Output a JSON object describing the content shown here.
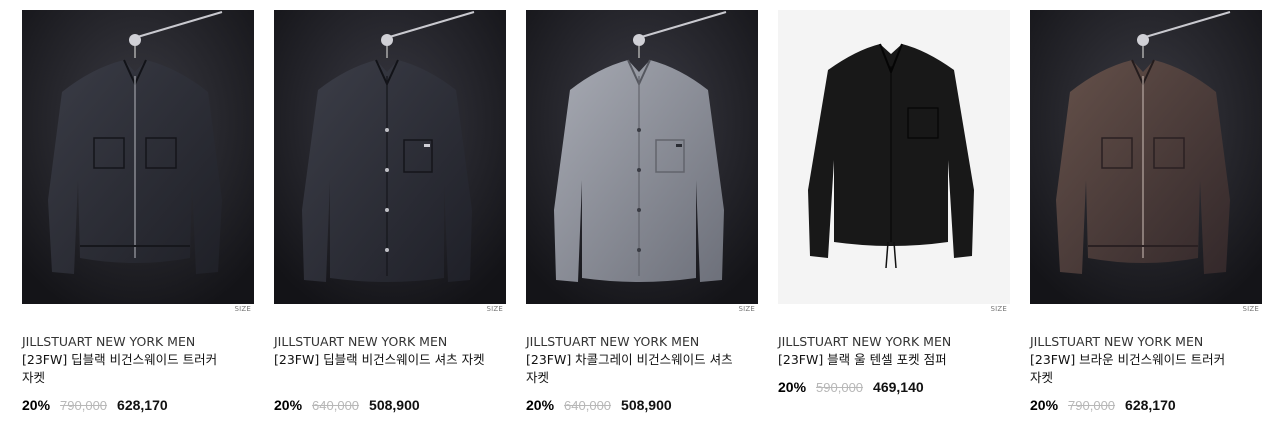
{
  "size_label": "SIZE",
  "products": [
    {
      "brand": "JILLSTUART NEW YORK MEN",
      "name": "[23FW] 딥블랙 비건스웨이드 트러커 자켓",
      "discount": "20%",
      "original_price": "790,000",
      "sale_price": "628,170",
      "colors": {
        "background": "#1c1c21",
        "jacket": "#2b2d35"
      }
    },
    {
      "brand": "JILLSTUART NEW YORK MEN",
      "name": "[23FW] 딥블랙 비건스웨이드 셔츠 자켓",
      "discount": "20%",
      "original_price": "640,000",
      "sale_price": "508,900",
      "colors": {
        "background": "#1b1b20",
        "jacket": "#2e3039"
      }
    },
    {
      "brand": "JILLSTUART NEW YORK MEN",
      "name": "[23FW] 차콜그레이 비건스웨이드 셔츠 자켓",
      "discount": "20%",
      "original_price": "640,000",
      "sale_price": "508,900",
      "colors": {
        "background": "#1d1d22",
        "jacket": "#8c8f99"
      }
    },
    {
      "brand": "JILLSTUART NEW YORK MEN",
      "name": "[23FW] 블랙 울 텐셀 포켓 점퍼",
      "discount": "20%",
      "original_price": "590,000",
      "sale_price": "469,140",
      "colors": {
        "background": "#f4f4f4",
        "jacket": "#151515"
      }
    },
    {
      "brand": "JILLSTUART NEW YORK MEN",
      "name": "[23FW] 브라운 비건스웨이드 트러커 자켓",
      "discount": "20%",
      "original_price": "790,000",
      "sale_price": "628,170",
      "colors": {
        "background": "#1c1c21",
        "jacket": "#4a3a34"
      }
    }
  ]
}
